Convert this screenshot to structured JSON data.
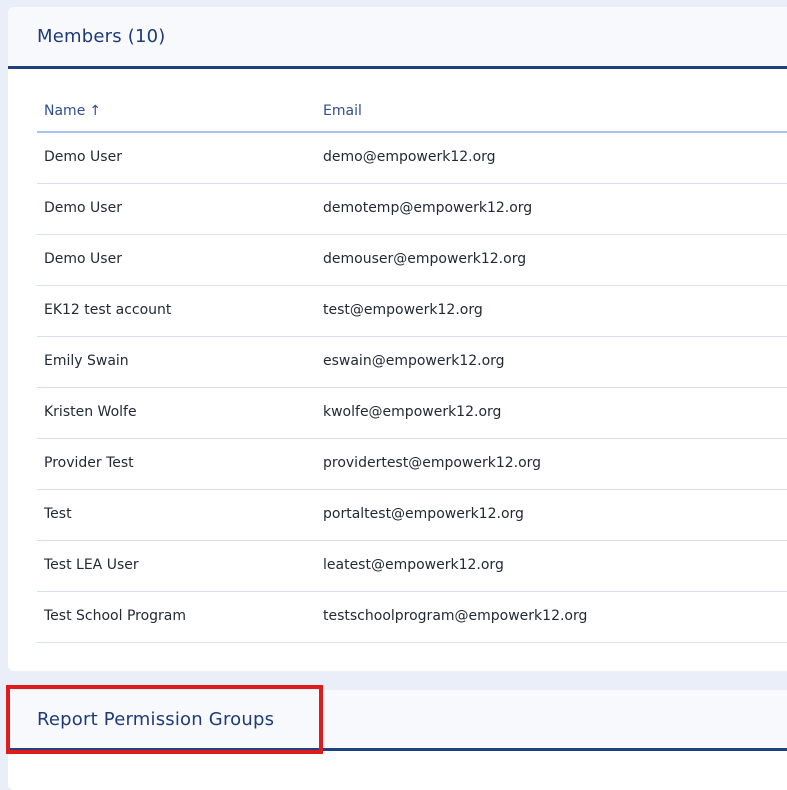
{
  "members_card": {
    "title": "Members (10)",
    "columns": {
      "name": "Name",
      "name_sort_indicator": "↑",
      "email": "Email"
    },
    "rows": [
      {
        "name": "Demo User",
        "email": "demo@empowerk12.org"
      },
      {
        "name": "Demo User",
        "email": "demotemp@empowerk12.org"
      },
      {
        "name": "Demo User",
        "email": "demouser@empowerk12.org"
      },
      {
        "name": "EK12 test account",
        "email": "test@empowerk12.org"
      },
      {
        "name": "Emily Swain",
        "email": "eswain@empowerk12.org"
      },
      {
        "name": "Kristen Wolfe",
        "email": "kwolfe@empowerk12.org"
      },
      {
        "name": "Provider Test",
        "email": "providertest@empowerk12.org"
      },
      {
        "name": "Test",
        "email": "portaltest@empowerk12.org"
      },
      {
        "name": "Test LEA User",
        "email": "leatest@empowerk12.org"
      },
      {
        "name": "Test School Program",
        "email": "testschoolprogram@empowerk12.org"
      }
    ]
  },
  "report_permission_groups_card": {
    "title": "Report Permission Groups"
  },
  "colors": {
    "page_background": "#e9eef9",
    "card_header_background": "#f7f9fd",
    "header_underline": "#20407f",
    "title_text": "#1e3a78",
    "table_header_border": "#a8c2f0",
    "highlight_outline": "#e01b1b"
  }
}
